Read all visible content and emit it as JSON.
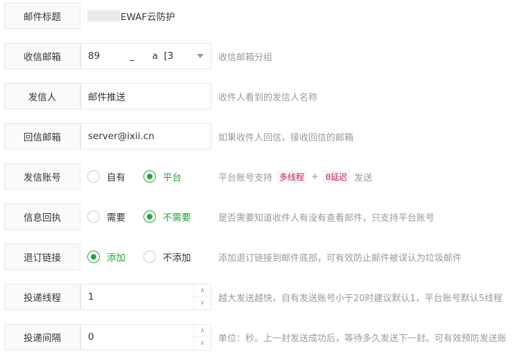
{
  "subject": {
    "label": "邮件标题",
    "value_blur": "xxxxxx",
    "value": "EWAF云防护"
  },
  "recipients": {
    "label": "收信邮箱",
    "value": "89          _      a  [3",
    "hint": "收信邮箱分组"
  },
  "sender": {
    "label": "发信人",
    "value": "邮件推送",
    "hint": "收件人看到的发信人名称"
  },
  "reply": {
    "label": "回信邮箱",
    "value": "server@ixii.cn",
    "hint": "如果收件人回信，接收回信的邮箱"
  },
  "account": {
    "label": "发信账号",
    "options": [
      "自有",
      "平台"
    ],
    "selected": 1,
    "hint_pre": "平台账号支持",
    "code1": "多线程",
    "plus": "+",
    "code2": "0延迟",
    "hint_post": "发送"
  },
  "receipt": {
    "label": "信息回执",
    "options": [
      "需要",
      "不需要"
    ],
    "selected": 1,
    "hint": "是否需要知道收件人有没有查看邮件，只支持平台账号"
  },
  "unsubscribe": {
    "label": "退订链接",
    "options": [
      "添加",
      "不添加"
    ],
    "selected": 0,
    "hint": "添加退订链接到邮件底部，可有效防止邮件被误认为垃圾邮件"
  },
  "threads": {
    "label": "投递线程",
    "value": "1",
    "hint": "越大发送越快，自有发送账号小于20时建议默认1，平台账号默认5线程"
  },
  "interval": {
    "label": "投递间隔",
    "value": "0",
    "hint": "单位：秒。上一封发送成功后，等待多久发送下一封。可有效预防发送账"
  },
  "colors": {
    "accent": "#20a53a",
    "hint": "#999999",
    "border": "#e6e6e6"
  }
}
